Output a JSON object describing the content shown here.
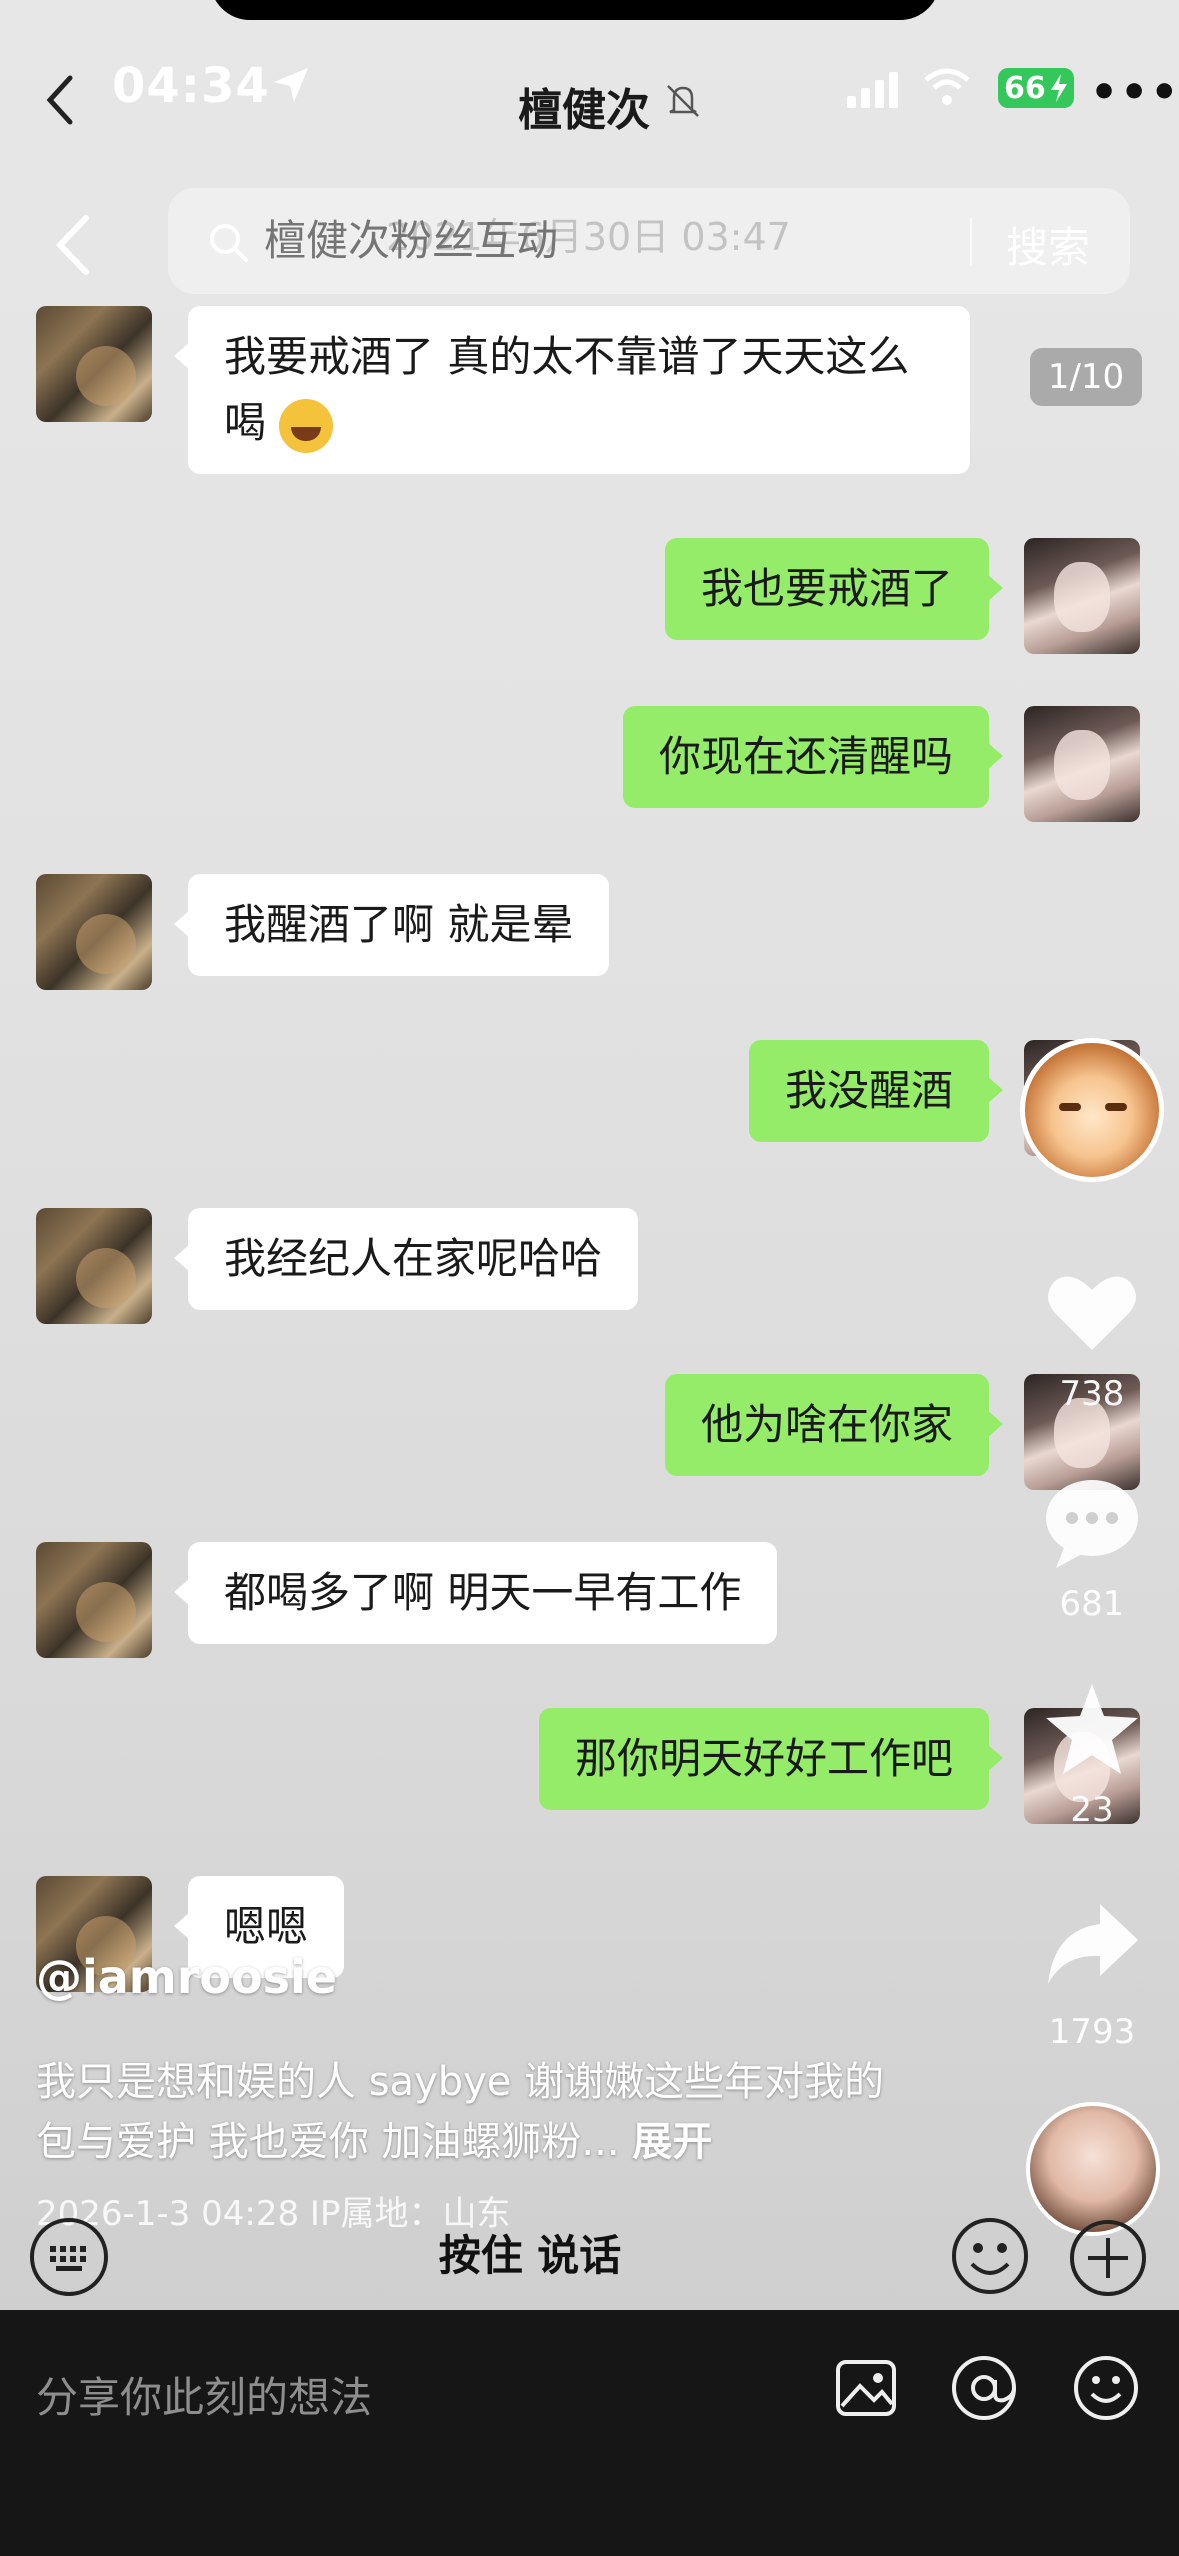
{
  "status_bar": {
    "time": "04:34",
    "battery": "66"
  },
  "chat": {
    "title": "檀健次"
  },
  "search": {
    "placeholder": "檀健次粉丝互动",
    "button": "搜索"
  },
  "timestamp": "2021年6月30日 03:47",
  "page_counter": "1/10",
  "messages": [
    {
      "side": "left",
      "text": "我要戒酒了 真的太不靠谱了天天这么喝"
    },
    {
      "side": "right",
      "text": "我也要戒酒了"
    },
    {
      "side": "right",
      "text": "你现在还清醒吗"
    },
    {
      "side": "left",
      "text": "我醒酒了啊 就是晕"
    },
    {
      "side": "right",
      "text": "我没醒酒"
    },
    {
      "side": "left",
      "text": "我经纪人在家呢哈哈"
    },
    {
      "side": "right",
      "text": "他为啥在你家"
    },
    {
      "side": "left",
      "text": "都喝多了啊 明天一早有工作"
    },
    {
      "side": "right",
      "text": "那你明天好好工作吧"
    },
    {
      "side": "left",
      "text": "嗯嗯"
    }
  ],
  "rail": {
    "likes": "738",
    "comments": "681",
    "favorites": "23",
    "shares": "1793"
  },
  "post": {
    "author": "@iamroosie",
    "caption": "我只是想和娱的人 saybye 谢谢嫩这些年对我的包与爱护 我也爱你 加油螺狮粉...",
    "expand_label": "展开",
    "meta": "2026-1-3 04:28   IP属地：山东"
  },
  "input_bar": {
    "hold_to_talk": "按住 说话"
  },
  "comment_bar": {
    "placeholder": "分享你此刻的想法"
  }
}
